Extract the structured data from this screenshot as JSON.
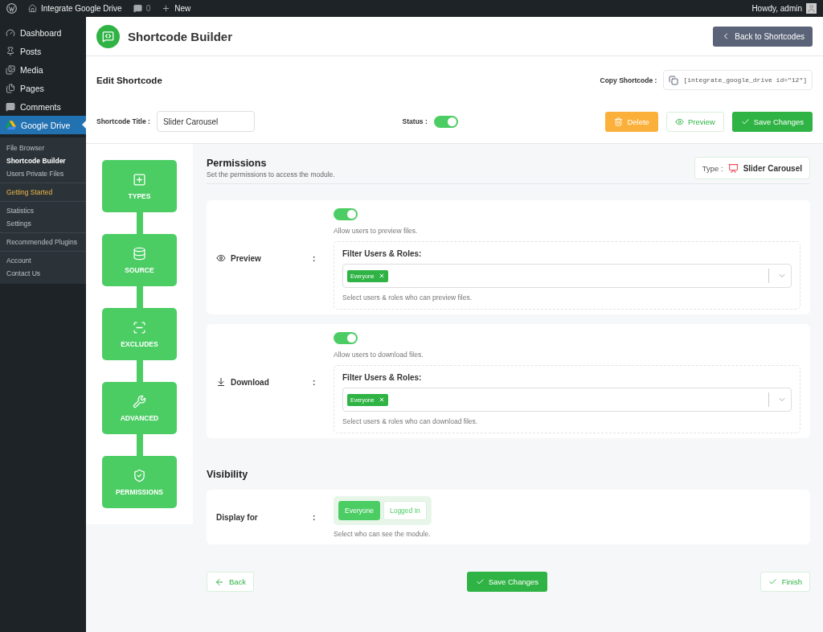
{
  "admin_bar": {
    "site": "Integrate Google Drive",
    "comments_count": "0",
    "new_label": "New",
    "greeting": "Howdy, admin"
  },
  "sidebar": {
    "menu": [
      {
        "label": "Dashboard",
        "kind": "dashboard",
        "selected": false
      },
      {
        "label": "Posts",
        "kind": "posts",
        "selected": false
      },
      {
        "label": "Media",
        "kind": "media",
        "selected": false
      },
      {
        "label": "Pages",
        "kind": "pages",
        "selected": false
      },
      {
        "label": "Comments",
        "kind": "comments",
        "selected": false
      },
      {
        "label": "Google Drive",
        "kind": "drive",
        "selected": true
      }
    ],
    "submenu": [
      [
        {
          "label": "File Browser",
          "kind": "link",
          "selected": false
        },
        {
          "label": "Shortcode Builder",
          "kind": "link",
          "selected": true
        },
        {
          "label": "Users Private Files",
          "kind": "link",
          "selected": false
        }
      ],
      [
        {
          "label": "Getting Started",
          "kind": "highlight",
          "selected": false
        }
      ],
      [
        {
          "label": "Statistics",
          "kind": "link",
          "selected": false
        },
        {
          "label": "Settings",
          "kind": "link",
          "selected": false
        }
      ],
      [
        {
          "label": "Recommended Plugins",
          "kind": "link",
          "selected": false
        }
      ],
      [
        {
          "label": "Account",
          "kind": "link",
          "selected": false
        },
        {
          "label": "Contact Us",
          "kind": "link",
          "selected": false
        }
      ]
    ]
  },
  "header": {
    "title": "Shortcode Builder",
    "back_button": "Back to Shortcodes"
  },
  "edit": {
    "heading": "Edit Shortcode",
    "copy_label": "Copy Shortcode :",
    "shortcode": "[integrate_google_drive id=\"12\"]",
    "title_label": "Shortcode Title :",
    "title_value": "Slider Carousel",
    "status_label": "Status :",
    "status_on": true,
    "buttons": [
      {
        "label": "Delete",
        "kind": "delete"
      },
      {
        "label": "Preview",
        "kind": "preview"
      },
      {
        "label": "Save Changes",
        "kind": "save"
      }
    ]
  },
  "steps": [
    {
      "label": "TYPES",
      "kind": "types"
    },
    {
      "label": "SOURCE",
      "kind": "source"
    },
    {
      "label": "EXCLUDES",
      "kind": "excludes"
    },
    {
      "label": "ADVANCED",
      "kind": "advanced"
    },
    {
      "label": "PERMISSIONS",
      "kind": "permissions"
    }
  ],
  "permissions": {
    "title": "Permissions",
    "subtitle": "Set the permissions to access the module.",
    "type_label": "Type :",
    "type_value": "Slider Carousel",
    "rows": [
      {
        "label": "Preview",
        "separator": ":",
        "kind": "preview",
        "on": true,
        "hint": "Allow users to preview files.",
        "filter_label": "Filter Users & Roles:",
        "tags": [
          "Everyone"
        ],
        "filter_hint": "Select users & roles who can preview files."
      },
      {
        "label": "Download",
        "separator": ":",
        "kind": "download",
        "on": true,
        "hint": "Allow users to download files.",
        "filter_label": "Filter Users & Roles:",
        "tags": [
          "Everyone"
        ],
        "filter_hint": "Select users & roles who can download files."
      }
    ]
  },
  "visibility": {
    "title": "Visibility",
    "label": "Display for",
    "separator": ":",
    "options": [
      {
        "label": "Everyone",
        "selected": true
      },
      {
        "label": "Logged In",
        "selected": false
      }
    ],
    "hint": "Select who can see the module."
  },
  "footer": {
    "back": "Back",
    "save": "Save Changes",
    "finish": "Finish"
  }
}
